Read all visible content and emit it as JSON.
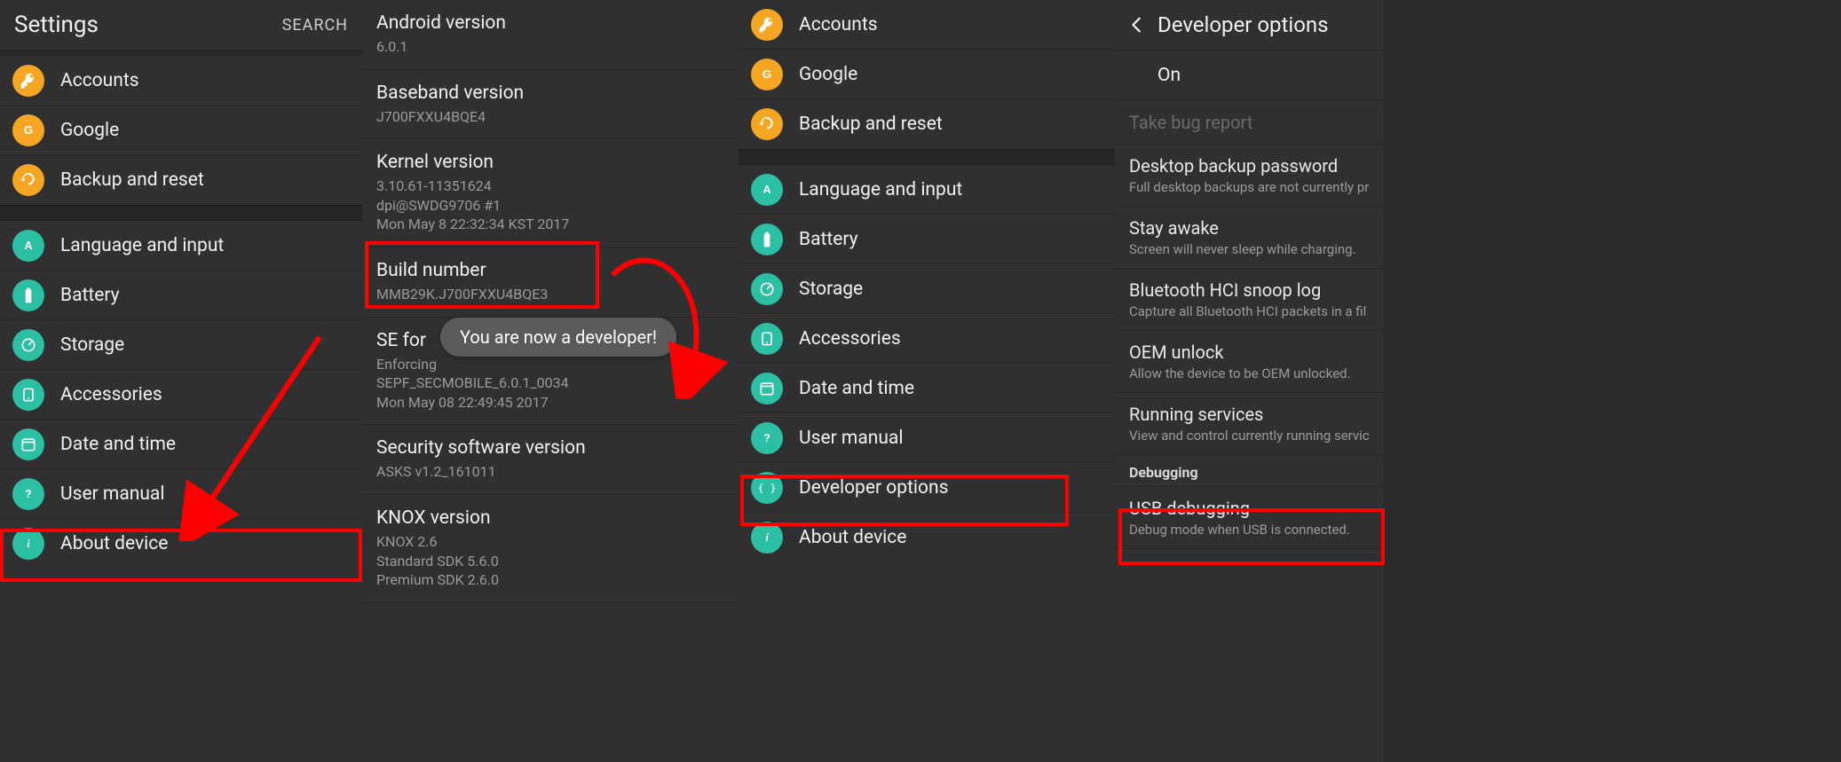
{
  "panel1": {
    "title": "Settings",
    "search": "SEARCH",
    "items_a": [
      {
        "icon": "key-icon",
        "color": "ic-orange",
        "label": "Accounts"
      },
      {
        "icon": "google-icon",
        "color": "ic-orange",
        "label": "Google"
      },
      {
        "icon": "backup-icon",
        "color": "ic-orange",
        "label": "Backup and reset"
      }
    ],
    "items_b": [
      {
        "icon": "language-icon",
        "color": "ic-teal",
        "label": "Language and input"
      },
      {
        "icon": "battery-icon",
        "color": "ic-teal",
        "label": "Battery"
      },
      {
        "icon": "storage-icon",
        "color": "ic-teal",
        "label": "Storage"
      },
      {
        "icon": "accessories-icon",
        "color": "ic-teal",
        "label": "Accessories"
      },
      {
        "icon": "datetime-icon",
        "color": "ic-teal",
        "label": "Date and time"
      },
      {
        "icon": "manual-icon",
        "color": "ic-teal",
        "label": "User manual"
      },
      {
        "icon": "about-icon",
        "color": "ic-teal",
        "label": "About device"
      }
    ]
  },
  "panel2": {
    "rows": [
      {
        "title": "Android version",
        "sub": "6.0.1"
      },
      {
        "title": "Baseband version",
        "sub": "J700FXXU4BQE4"
      },
      {
        "title": "Kernel version",
        "sub": "3.10.61-11351624\ndpi@SWDG9706 #1\nMon May 8 22:32:34 KST 2017"
      },
      {
        "title": "Build number",
        "sub": "MMB29K.J700FXXU4BQE3"
      },
      {
        "title": "SE for ",
        "sub": "Enforcing\nSEPF_SECMOBILE_6.0.1_0034\nMon May 08 22:49:45 2017"
      },
      {
        "title": "Security software version",
        "sub": "ASKS v1.2_161011"
      },
      {
        "title": "KNOX version",
        "sub": "KNOX 2.6\nStandard SDK 5.6.0\nPremium SDK 2.6.0"
      }
    ],
    "toast": "You are now a developer!"
  },
  "panel3": {
    "items_a": [
      {
        "icon": "key-icon",
        "color": "ic-orange",
        "label": "Accounts"
      },
      {
        "icon": "google-icon",
        "color": "ic-orange",
        "label": "Google"
      },
      {
        "icon": "backup-icon",
        "color": "ic-orange",
        "label": "Backup and reset"
      }
    ],
    "items_b": [
      {
        "icon": "language-icon",
        "color": "ic-teal",
        "label": "Language and input"
      },
      {
        "icon": "battery-icon",
        "color": "ic-teal",
        "label": "Battery"
      },
      {
        "icon": "storage-icon",
        "color": "ic-teal",
        "label": "Storage"
      },
      {
        "icon": "accessories-icon",
        "color": "ic-teal",
        "label": "Accessories"
      },
      {
        "icon": "datetime-icon",
        "color": "ic-teal",
        "label": "Date and time"
      },
      {
        "icon": "manual-icon",
        "color": "ic-teal",
        "label": "User manual"
      },
      {
        "icon": "devopts-icon",
        "color": "ic-teal",
        "label": "Developer options"
      },
      {
        "icon": "about-icon",
        "color": "ic-teal",
        "label": "About device"
      }
    ]
  },
  "panel4": {
    "title": "Developer options",
    "on": "On",
    "rows": [
      {
        "title": "Take bug report",
        "sub": "",
        "disabled": true
      },
      {
        "title": "Desktop backup password",
        "sub": "Full desktop backups are not currently pr"
      },
      {
        "title": "Stay awake",
        "sub": "Screen will never sleep while charging."
      },
      {
        "title": "Bluetooth HCI snoop log",
        "sub": "Capture all Bluetooth HCI packets in a fil"
      },
      {
        "title": "OEM unlock",
        "sub": "Allow the device to be OEM unlocked."
      },
      {
        "title": "Running services",
        "sub": "View and control currently running servic"
      }
    ],
    "cat": "Debugging",
    "rows2": [
      {
        "title": "USB debugging",
        "sub": "Debug mode when USB is connected."
      }
    ]
  }
}
